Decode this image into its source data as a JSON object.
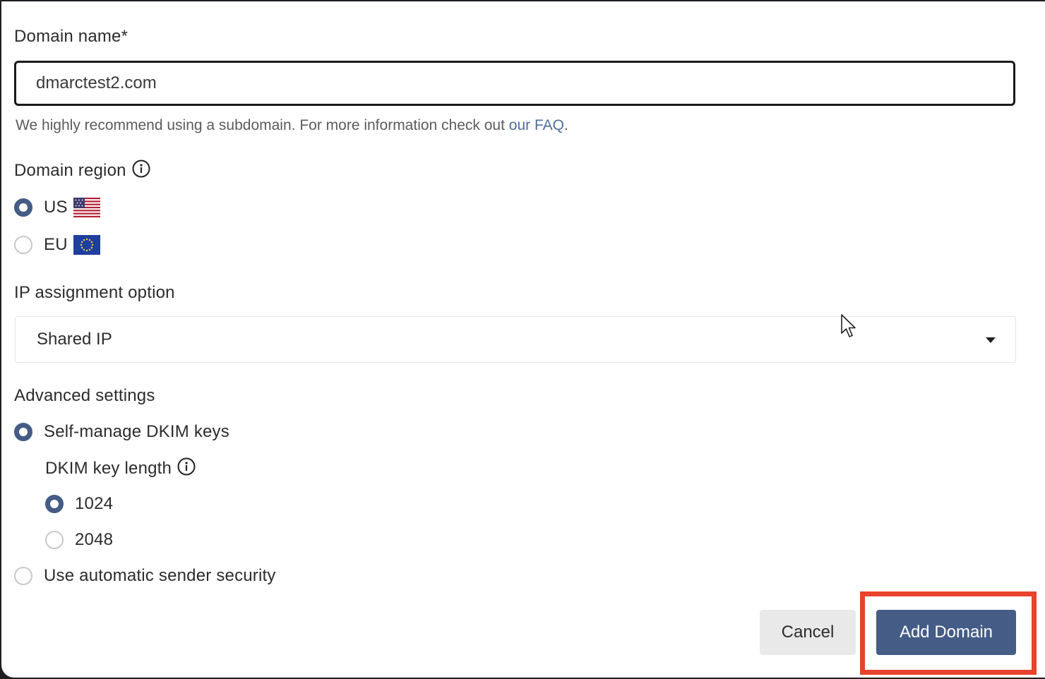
{
  "form": {
    "domain_name_label": "Domain name*",
    "domain_name_value": "dmarctest2.com",
    "help_text": "We highly recommend using a subdomain. For more information check out ",
    "help_link": "our FAQ",
    "help_suffix": ".",
    "region_label": "Domain region",
    "regions": [
      {
        "label": "US",
        "flag": "us-flag-icon",
        "checked": true
      },
      {
        "label": "EU",
        "flag": "eu-flag-icon",
        "checked": false
      }
    ],
    "ip_label": "IP assignment option",
    "ip_selected": "Shared IP",
    "advanced_label": "Advanced settings",
    "dkim_self_manage": "Self-manage DKIM keys",
    "dkim_length_label": "DKIM key length",
    "dkim_lengths": [
      {
        "label": "1024",
        "checked": true
      },
      {
        "label": "2048",
        "checked": false
      }
    ],
    "auto_security": "Use automatic sender security"
  },
  "actions": {
    "cancel": "Cancel",
    "add_domain": "Add Domain"
  },
  "colors": {
    "primary": "#445c86",
    "link": "#4d6e9e",
    "highlight": "#e8432d",
    "cancel_bg": "#e9e9ea"
  }
}
